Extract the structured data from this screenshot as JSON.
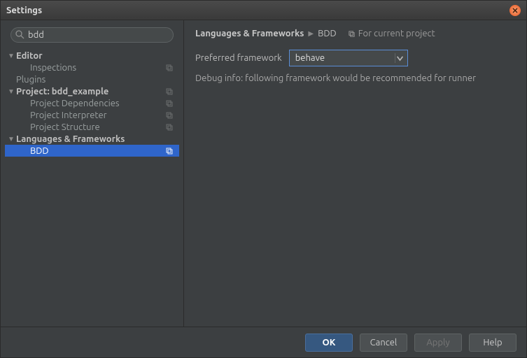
{
  "window": {
    "title": "Settings"
  },
  "search": {
    "value": "bdd"
  },
  "tree": {
    "editor": {
      "label": "Editor",
      "inspections": "Inspections",
      "plugins": "Plugins"
    },
    "project": {
      "label": "Project: bdd_example",
      "deps": "Project Dependencies",
      "interp": "Project Interpreter",
      "struct": "Project Structure"
    },
    "lang": {
      "label": "Languages & Frameworks",
      "bdd": "BDD"
    }
  },
  "breadcrumb": {
    "group": "Languages & Frameworks",
    "page": "BDD",
    "scope": "For current project"
  },
  "form": {
    "preferred_label": "Preferred framework",
    "preferred_value": "behave",
    "debug_info": "Debug info: following framework would be recommended for runner"
  },
  "buttons": {
    "ok": "OK",
    "cancel": "Cancel",
    "apply": "Apply",
    "help": "Help"
  }
}
